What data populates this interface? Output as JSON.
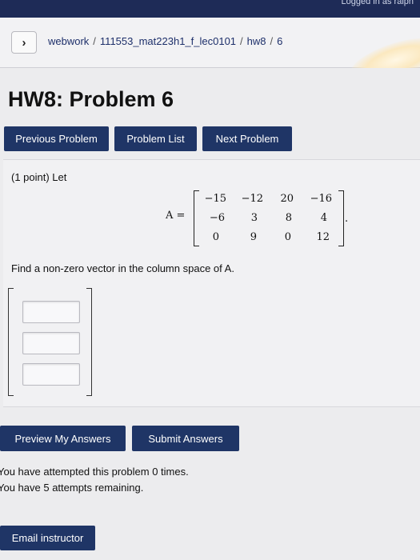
{
  "header": {
    "login_text": "Logged in as ralph"
  },
  "breadcrumb": {
    "items": [
      "webwork",
      "111553_mat223h1_f_lec0101",
      "hw8",
      "6"
    ],
    "separator": "/"
  },
  "page": {
    "title": "HW8: Problem 6"
  },
  "nav": {
    "previous": "Previous Problem",
    "list": "Problem List",
    "next": "Next Problem"
  },
  "problem": {
    "intro": "(1 point) Let",
    "matrix_label": "A =",
    "matrix": [
      [
        "−15",
        "−12",
        "20",
        "−16"
      ],
      [
        "−6",
        "3",
        "8",
        "4"
      ],
      [
        "0",
        "9",
        "0",
        "12"
      ]
    ],
    "matrix_end": ".",
    "question": "Find a non-zero vector in the column space of A.",
    "answers": [
      {
        "value": ""
      },
      {
        "value": ""
      },
      {
        "value": ""
      }
    ]
  },
  "actions": {
    "preview": "Preview My Answers",
    "submit": "Submit Answers"
  },
  "status": {
    "attempted": "You have attempted this problem 0 times.",
    "remaining": "You have 5 attempts remaining."
  },
  "footer": {
    "email": "Email instructor"
  },
  "colors": {
    "topbar": "#1e2b57",
    "button": "#1f3566",
    "link": "#1d2f6a"
  }
}
